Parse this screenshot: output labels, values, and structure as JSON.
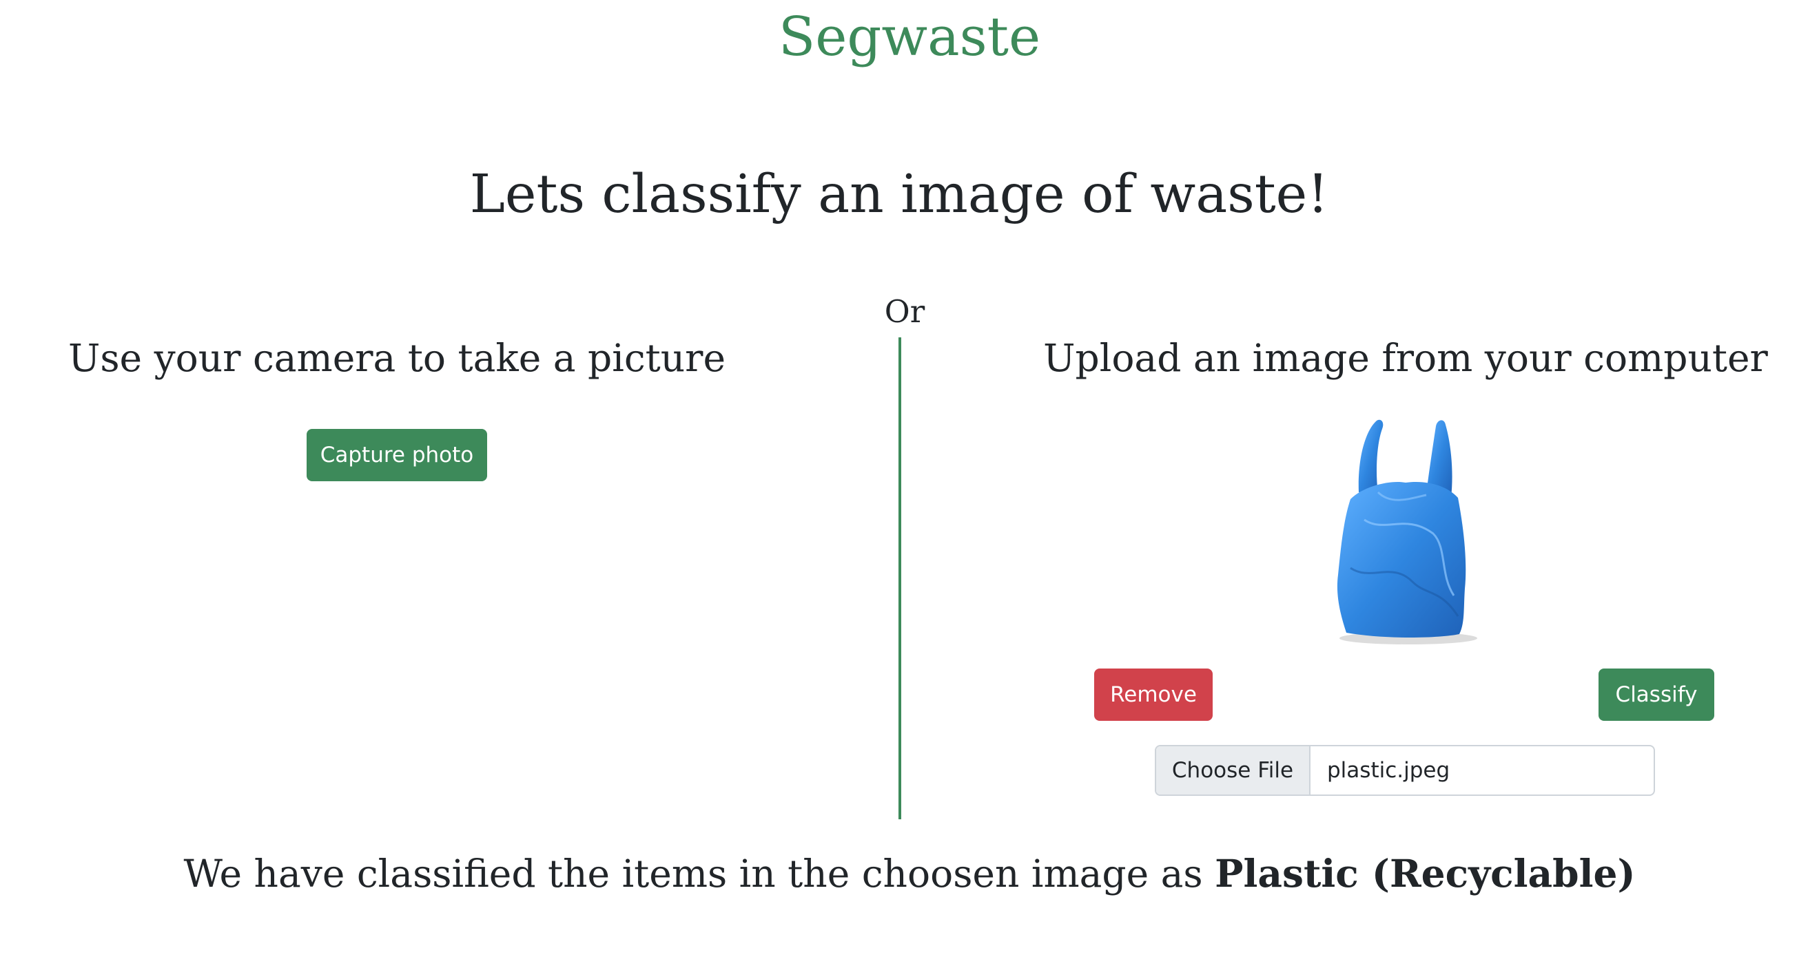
{
  "brand": {
    "title": "Segwaste"
  },
  "headline": "Lets classify an image of waste!",
  "divider_label": "Or",
  "camera": {
    "title": "Use your camera to take a picture",
    "capture_label": "Capture photo"
  },
  "upload": {
    "title": "Upload an image from your computer",
    "preview_icon": "plastic-bag-image",
    "remove_label": "Remove",
    "classify_label": "Classify",
    "choose_file_label": "Choose File",
    "file_name": "plastic.jpeg"
  },
  "result": {
    "prefix": "We have classified the items in the choosen image as ",
    "label": "Plastic (Recyclable)"
  },
  "colors": {
    "accent_green": "#3d8a5a",
    "danger_red": "#d1424b",
    "bag_blue": "#3a8fde"
  }
}
